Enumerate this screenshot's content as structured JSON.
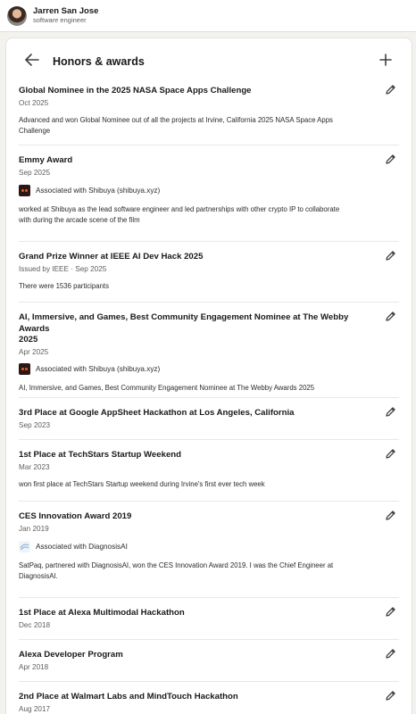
{
  "profile": {
    "name": "Jarren San Jose",
    "headline": "software engineer"
  },
  "section": {
    "title": "Honors & awards"
  },
  "icons": {
    "back": "arrow-left-icon",
    "add": "plus-icon",
    "edit": "pencil-icon"
  },
  "items": [
    {
      "title": "Global Nominee in the 2025 NASA Space Apps Challenge",
      "date": "Oct 2025",
      "desc": [
        "Advanced and won Global Nominee out of all the projects at Irvine, California 2025 NASA Space Apps",
        "Challenge"
      ]
    },
    {
      "title": "Emmy Award",
      "date": "Sep 2025",
      "assoc": "Associated with Shibuya (shibuya.xyz)",
      "desc": [
        "worked at Shibuya as the lead software engineer and led partnerships with other crypto IP to collaborate",
        "with during the arcade scene of the film"
      ]
    },
    {
      "title": "Grand Prize Winner at IEEE AI Dev Hack 2025",
      "date": "Issued by IEEE · Sep 2025",
      "desc": [
        "There were 1536 participants"
      ]
    },
    {
      "title": [
        "AI, Immersive, and Games, Best Community Engagement Nominee at The Webby Awards",
        "2025"
      ],
      "date": "Apr 2025",
      "assoc": "Associated with Shibuya (shibuya.xyz)",
      "desc": [
        "AI, Immersive, and Games, Best Community Engagement Nominee at The Webby Awards 2025"
      ]
    },
    {
      "title": "3rd Place at Google AppSheet Hackathon at Los Angeles, California",
      "date": "Sep 2023"
    },
    {
      "title": "1st Place at TechStars Startup Weekend",
      "date": "Mar 2023",
      "desc": [
        "won first place at TechStars Startup weekend during Irvine's first ever tech week"
      ]
    },
    {
      "title": "CES Innovation Award 2019",
      "date": "Jan 2019",
      "assoc": "Associated with DiagnosisAI",
      "desc": [
        "SatPaq,  partnered with DiagnosisAI, won the CES Innovation Award 2019. I was the Chief Engineer at",
        "DiagnosisAI."
      ]
    },
    {
      "title": "1st Place at Alexa Multimodal Hackathon",
      "date": "Dec 2018"
    },
    {
      "title": "Alexa Developer Program",
      "date": "Apr 2018"
    },
    {
      "title": "2nd Place at Walmart Labs and MindTouch Hackathon",
      "date": "Aug 2017"
    }
  ]
}
